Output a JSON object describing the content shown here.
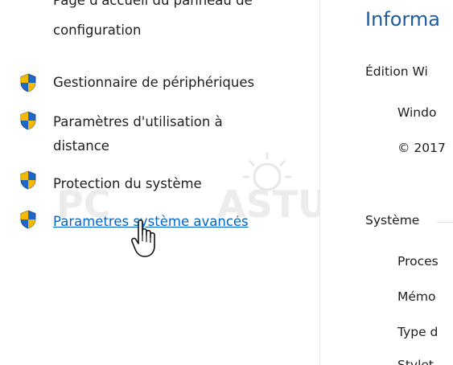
{
  "left_panel": {
    "cut_top_label": "Page d'accueil du panneau de",
    "config_label": "configuration",
    "items": [
      {
        "label": "Gestionnaire de périphériques",
        "icon": "uac-shield-icon"
      },
      {
        "label_line1": "Paramètres d'utilisation à",
        "label_line2": "distance",
        "icon": "uac-shield-icon"
      },
      {
        "label": "Protection du système",
        "icon": "uac-shield-icon"
      },
      {
        "label": "Paramètres système avancés",
        "icon": "uac-shield-icon"
      }
    ]
  },
  "watermark": {
    "text_left": "PC",
    "text_right": "ASTUCES"
  },
  "right_panel": {
    "title": "Informa",
    "edition_label": "Édition Wi",
    "windows_label": "Windo",
    "copyright_label": "© 2017",
    "section_system": "Système",
    "rows": [
      "Proces",
      "Mémo",
      "Type d",
      "Stylet"
    ]
  },
  "colors": {
    "link": "#0066cc",
    "title_blue": "#1e5aa0",
    "shield_blue": "#1f67c5",
    "shield_yellow": "#f5b800"
  }
}
